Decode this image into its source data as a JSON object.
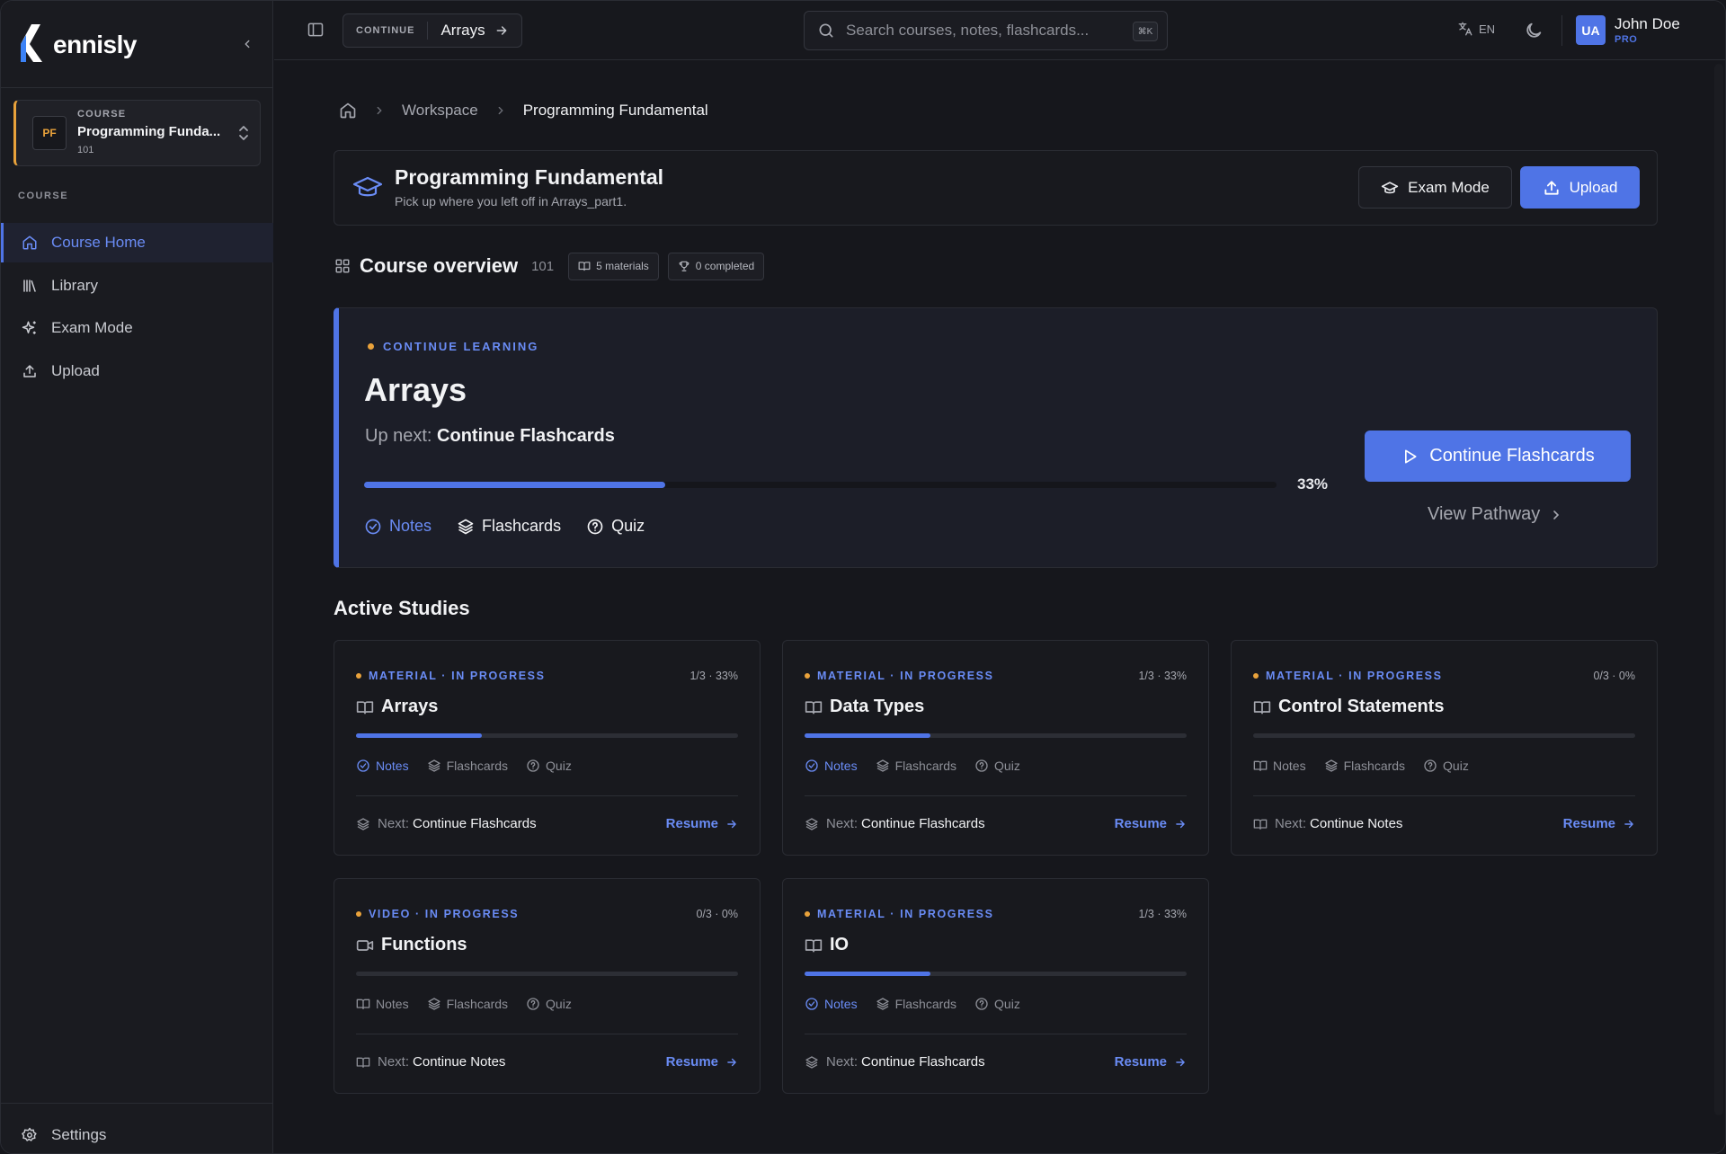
{
  "app": {
    "brand": "ennisly",
    "colors": {
      "accent": "#4f74e6",
      "accent_text": "#6a8cf5",
      "warning_dot": "#e9a23b",
      "background": "#16171c"
    }
  },
  "sidebar": {
    "course_switcher": {
      "badge": "PF",
      "kicker": "COURSE",
      "title": "Programming Funda...",
      "code": "101"
    },
    "section_label": "COURSE",
    "items": [
      {
        "label": "Course Home",
        "icon": "home-icon",
        "active": true
      },
      {
        "label": "Library",
        "icon": "library-icon",
        "active": false
      },
      {
        "label": "Exam Mode",
        "icon": "sparkles-icon",
        "active": false
      },
      {
        "label": "Upload",
        "icon": "upload-icon",
        "active": false
      }
    ],
    "settings_label": "Settings"
  },
  "topbar": {
    "continue_label": "CONTINUE",
    "continue_value": "Arrays",
    "search_placeholder": "Search courses, notes, flashcards...",
    "search_shortcut": "⌘K",
    "language": "EN",
    "user": {
      "initials": "UA",
      "name": "John Doe",
      "plan": "PRO"
    }
  },
  "breadcrumb": {
    "items": [
      "Workspace",
      "Programming Fundamental"
    ]
  },
  "header": {
    "title": "Programming Fundamental",
    "subtitle": "Pick up where you left off in Arrays_part1.",
    "exam_button": "Exam Mode",
    "upload_button": "Upload"
  },
  "overview": {
    "title": "Course overview",
    "code": "101",
    "materials": "5 materials",
    "completed": "0 completed"
  },
  "continue_learning": {
    "kicker": "CONTINUE LEARNING",
    "title": "Arrays",
    "next_label": "Up next:",
    "next_value": "Continue Flashcards",
    "progress": 0.33,
    "progress_label": "33%",
    "steps": [
      {
        "label": "Notes",
        "done": true,
        "icon": "check-circle-icon"
      },
      {
        "label": "Flashcards",
        "done": false,
        "icon": "layers-icon"
      },
      {
        "label": "Quiz",
        "done": false,
        "icon": "help-circle-icon"
      }
    ],
    "button": "Continue Flashcards",
    "pathway_link": "View Pathway"
  },
  "active_studies": {
    "title": "Active Studies",
    "step_labels": [
      "Notes",
      "Flashcards",
      "Quiz"
    ],
    "next_label": "Next:",
    "resume_label": "Resume",
    "cards": [
      {
        "kicker": "MATERIAL · IN PROGRESS",
        "count": "1/3 · 33%",
        "title": "Arrays",
        "type_icon": "book-icon",
        "progress": 0.33,
        "notes_done": true,
        "next_value": "Continue Flashcards",
        "next_icon": "layers-icon"
      },
      {
        "kicker": "MATERIAL · IN PROGRESS",
        "count": "1/3 · 33%",
        "title": "Data Types",
        "type_icon": "book-icon",
        "progress": 0.33,
        "notes_done": true,
        "next_value": "Continue Flashcards",
        "next_icon": "layers-icon"
      },
      {
        "kicker": "MATERIAL · IN PROGRESS",
        "count": "0/3 · 0%",
        "title": "Control Statements",
        "type_icon": "book-icon",
        "progress": 0,
        "notes_done": false,
        "next_value": "Continue Notes",
        "next_icon": "book-icon"
      },
      {
        "kicker": "VIDEO · IN PROGRESS",
        "count": "0/3 · 0%",
        "title": "Functions",
        "type_icon": "video-icon",
        "progress": 0,
        "notes_done": false,
        "next_value": "Continue Notes",
        "next_icon": "book-icon"
      },
      {
        "kicker": "MATERIAL · IN PROGRESS",
        "count": "1/3 · 33%",
        "title": "IO",
        "type_icon": "book-icon",
        "progress": 0.33,
        "notes_done": true,
        "next_value": "Continue Flashcards",
        "next_icon": "layers-icon"
      }
    ]
  }
}
